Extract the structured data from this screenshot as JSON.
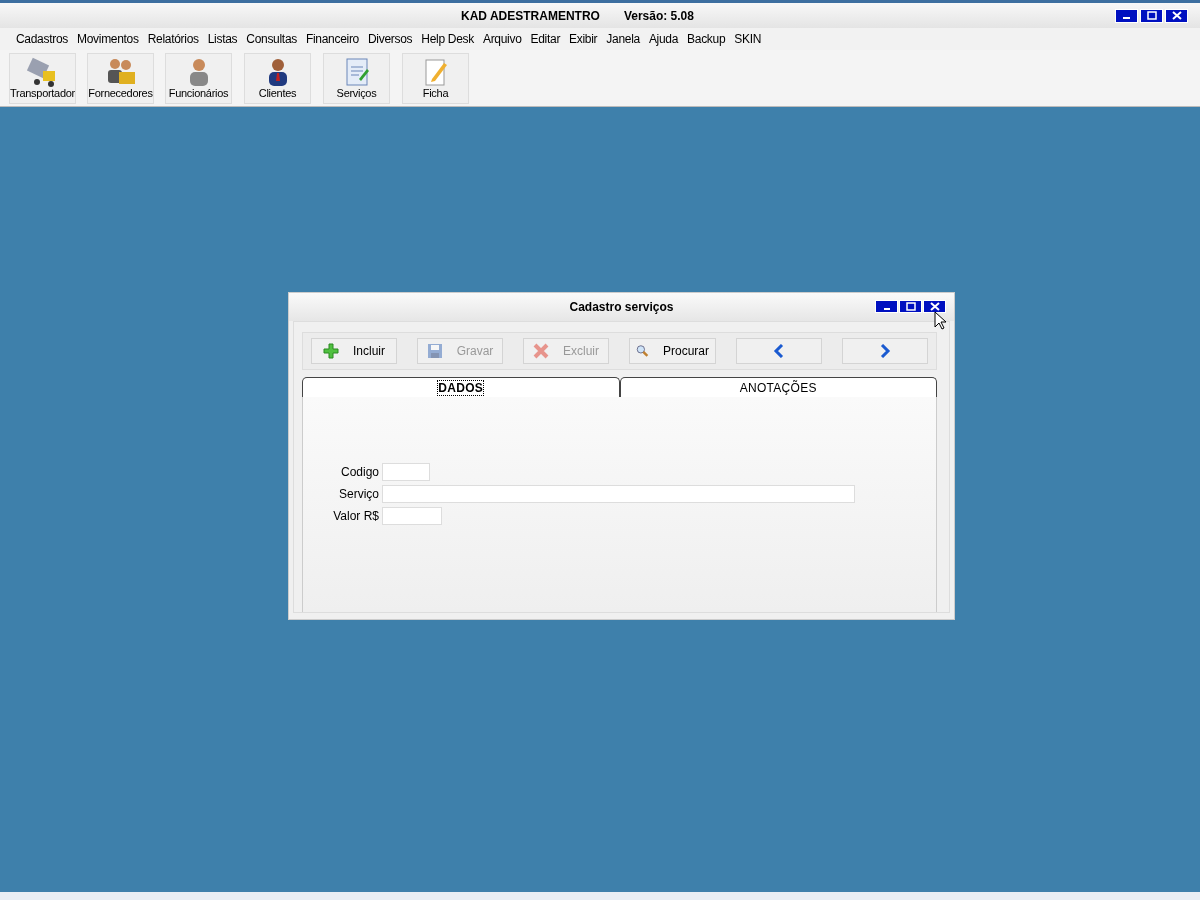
{
  "window": {
    "title": "KAD ADESTRAMENTRO",
    "version": "Versão: 5.08",
    "controls": [
      {
        "kind": "minimize"
      },
      {
        "kind": "maximize"
      },
      {
        "kind": "close"
      }
    ]
  },
  "menu": [
    "Cadastros",
    "Movimentos",
    "Relatórios",
    "Listas",
    "Consultas",
    "Financeiro",
    "Diversos",
    "Help Desk",
    "Arquivo",
    "Editar",
    "Exibir",
    "Janela",
    "Ajuda",
    "Backup",
    "SKIN"
  ],
  "toolbar": [
    {
      "label": "Transportador",
      "kind": "truck"
    },
    {
      "label": "Fornecedores",
      "kind": "people"
    },
    {
      "label": "Funcionários",
      "kind": "person"
    },
    {
      "label": "Clientes",
      "kind": "client"
    },
    {
      "label": "Serviços",
      "kind": "doc"
    },
    {
      "label": "Ficha",
      "kind": "pencil"
    }
  ],
  "dialog": {
    "title": "Cadastro serviços",
    "controls": [
      {
        "kind": "minimize"
      },
      {
        "kind": "maximize"
      },
      {
        "kind": "close"
      }
    ],
    "buttons": [
      {
        "label": "Incluir",
        "kind": "plus",
        "disabled": false
      },
      {
        "label": "Gravar",
        "kind": "save",
        "disabled": true
      },
      {
        "label": "Excluir",
        "kind": "delete",
        "disabled": true
      },
      {
        "label": "Procurar",
        "kind": "search",
        "disabled": false
      },
      {
        "kind": "prev",
        "disabled": false
      },
      {
        "kind": "next",
        "disabled": false
      }
    ],
    "tabs": [
      {
        "label": "DADOS",
        "selected": true
      },
      {
        "label": "ANOTAÇÕES",
        "selected": false
      }
    ],
    "fields": [
      {
        "label": "Codigo",
        "kind": "short"
      },
      {
        "label": "Serviço",
        "kind": "long"
      },
      {
        "label": "Valor R$",
        "kind": "medium"
      }
    ]
  }
}
